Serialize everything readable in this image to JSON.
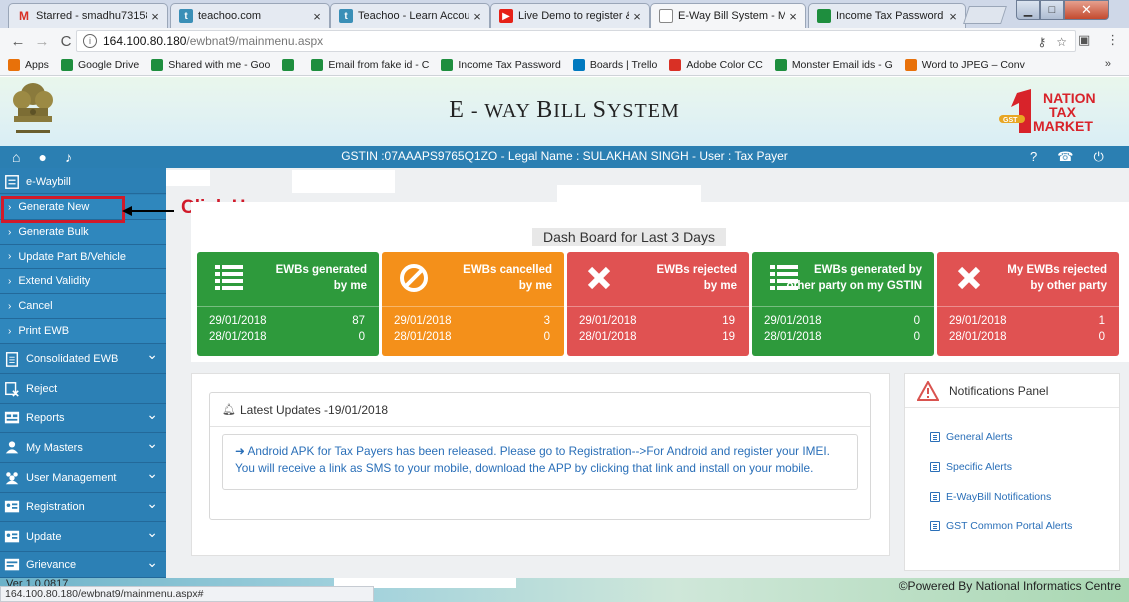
{
  "browser": {
    "tabs": [
      {
        "title": "Starred - smadhu73158",
        "fav": "M",
        "favColor": "#d93025",
        "favText": "#d93025",
        "active": false
      },
      {
        "title": "teachoo.com",
        "fav": "t",
        "favColor": "#3a8fb7",
        "active": false
      },
      {
        "title": "Teachoo - Learn Accounti",
        "fav": "t",
        "favColor": "#3a8fb7",
        "active": false
      },
      {
        "title": "Live Demo to register &",
        "fav": "▶",
        "favColor": "#e62117",
        "active": false
      },
      {
        "title": "E-Way Bill System - Main",
        "fav": "",
        "favColor": "#ffffff",
        "active": true
      },
      {
        "title": "Income Tax Password / A",
        "fav": "",
        "favColor": "#1e8e3e",
        "active": false
      }
    ],
    "url_host": "164.100.80.180",
    "url_path": "/ewbnat9/mainmenu.aspx",
    "bookmarks": [
      {
        "label": "Apps",
        "color": "#e8710a"
      },
      {
        "label": "Google Drive",
        "color": "#1e8e3e"
      },
      {
        "label": "Shared with me - Goo",
        "color": "#1e8e3e"
      },
      {
        "label": "",
        "color": "#1e8e3e"
      },
      {
        "label": "Email from fake id - C",
        "color": "#1e8e3e"
      },
      {
        "label": "Income Tax Password",
        "color": "#1e8e3e"
      },
      {
        "label": "Boards | Trello",
        "color": "#0079bf"
      },
      {
        "label": "Adobe Color CC",
        "color": "#d93025"
      },
      {
        "label": "Monster Email ids - G",
        "color": "#1e8e3e"
      },
      {
        "label": "Word to JPEG – Conv",
        "color": "#e8710a"
      }
    ],
    "bookmarks_more": "»",
    "status_url": "164.100.80.180/ewbnat9/mainmenu.aspx#"
  },
  "header": {
    "title_e": "E",
    "title_mid": " - W",
    "title_rest1": "AY ",
    "title_b": "B",
    "title_rest2": "ILL ",
    "title_s": "S",
    "title_rest3": "YSTEM",
    "brand_lines": [
      "NATION",
      "TAX",
      "MARKET"
    ],
    "brand_badge": "GST"
  },
  "infobar": {
    "gstin_text": "GSTIN :07AAAPS9765Q1ZO - Legal Name : SULAKHAN SINGH - User : Tax Payer"
  },
  "sidebar": {
    "items": [
      {
        "label": "e-Waybill",
        "kind": "head",
        "chevron": false
      },
      {
        "label": "Generate New",
        "kind": "sub"
      },
      {
        "label": "Generate Bulk",
        "kind": "sub"
      },
      {
        "label": "Update Part B/Vehicle",
        "kind": "sub"
      },
      {
        "label": "Extend Validity",
        "kind": "sub"
      },
      {
        "label": "Cancel",
        "kind": "sub"
      },
      {
        "label": "Print EWB",
        "kind": "sub"
      },
      {
        "label": "Consolidated EWB",
        "kind": "head",
        "chevron": true
      },
      {
        "label": "Reject",
        "kind": "head",
        "chevron": false
      },
      {
        "label": "Reports",
        "kind": "head",
        "chevron": true
      },
      {
        "label": "My Masters",
        "kind": "head",
        "chevron": true
      },
      {
        "label": "User Management",
        "kind": "head",
        "chevron": true
      },
      {
        "label": "Registration",
        "kind": "head",
        "chevron": true
      },
      {
        "label": "Update",
        "kind": "head",
        "chevron": true
      },
      {
        "label": "Grievance",
        "kind": "head",
        "chevron": true
      }
    ],
    "annotation": "Click Here"
  },
  "dashboard": {
    "title": "Dash Board for Last 3 Days",
    "cards": [
      {
        "line1": "EWBs generated",
        "line2": "by me",
        "color": "#2e9a3c",
        "icon": "list-icon",
        "rows": [
          {
            "date": "29/01/2018",
            "value": "87"
          },
          {
            "date": "28/01/2018",
            "value": "0"
          }
        ]
      },
      {
        "line1": "EWBs cancelled",
        "line2": "by me",
        "color": "#f4901a",
        "icon": "ban-icon",
        "rows": [
          {
            "date": "29/01/2018",
            "value": "3"
          },
          {
            "date": "28/01/2018",
            "value": "0"
          }
        ]
      },
      {
        "line1": "EWBs rejected",
        "line2": "by me",
        "color": "#e05252",
        "icon": "x-icon",
        "rows": [
          {
            "date": "29/01/2018",
            "value": "19"
          },
          {
            "date": "28/01/2018",
            "value": "19"
          }
        ]
      },
      {
        "line1": "EWBs generated by",
        "line2": "other party on my GSTIN",
        "color": "#2e9a3c",
        "icon": "list-icon",
        "rows": [
          {
            "date": "29/01/2018",
            "value": "0"
          },
          {
            "date": "28/01/2018",
            "value": "0"
          }
        ]
      },
      {
        "line1": "My EWBs rejected",
        "line2": "by other party",
        "color": "#e05252",
        "icon": "x-icon",
        "rows": [
          {
            "date": "29/01/2018",
            "value": "1"
          },
          {
            "date": "28/01/2018",
            "value": "0"
          }
        ]
      }
    ]
  },
  "updates": {
    "title": "Latest Updates -19/01/2018",
    "message": "➜ Android APK for Tax Payers has been released. Please go to Registration-->For Android and register your IMEI. You will receive a link as SMS to your mobile, download the APP by clicking that link and install on your mobile."
  },
  "notifications": {
    "title": "Notifications Panel",
    "items": [
      "General Alerts",
      "Specific Alerts",
      "E-WayBill Notifications",
      "GST Common Portal Alerts"
    ]
  },
  "footer": {
    "version": "Ver 1.0.0817",
    "powered": "©Powered By National Informatics Centre"
  }
}
